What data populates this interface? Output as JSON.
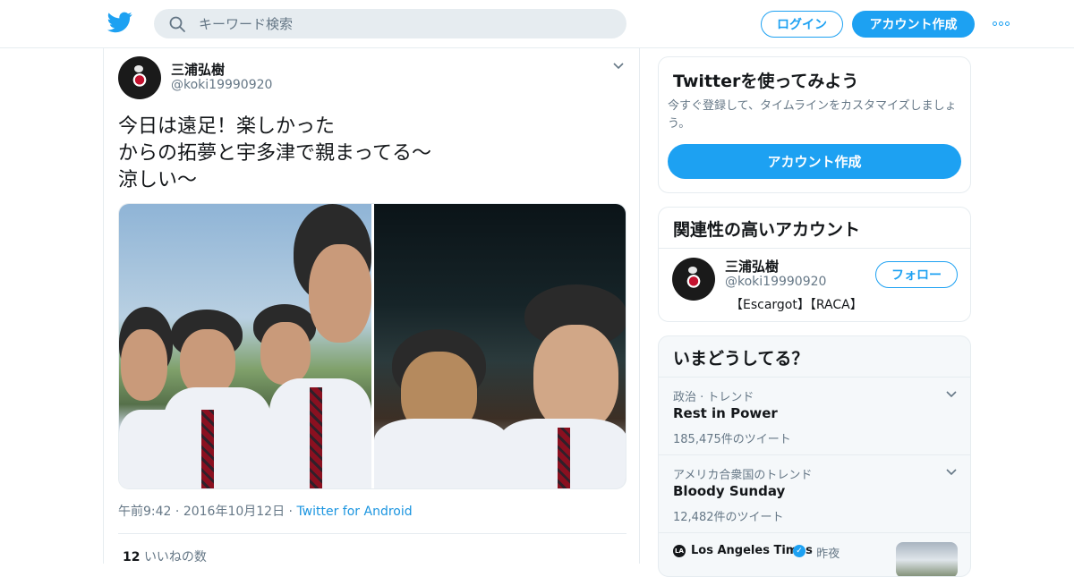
{
  "header": {
    "search_placeholder": "キーワード検索",
    "login_label": "ログイン",
    "signup_label": "アカウント作成"
  },
  "tweet": {
    "author_name": "三浦弘樹",
    "author_handle": "@koki19990920",
    "text_lines": [
      "今日は遠足！楽しかった",
      "からの拓夢と宇多津で親まってる～",
      "涼しい～"
    ],
    "time": "午前9:42",
    "date": "2016年10月12日",
    "client": "Twitter for Android",
    "likes_count": "12",
    "likes_label": "いいねの数"
  },
  "signup_card": {
    "title": "Twitterを使ってみよう",
    "description": "今すぐ登録して、タイムラインをカスタマイズしましょう。",
    "cta_label": "アカウント作成"
  },
  "related": {
    "title": "関連性の高いアカウント",
    "account": {
      "name": "三浦弘樹",
      "handle": "@koki19990920",
      "bio": "【Escargot】【RACA】",
      "follow_label": "フォロー"
    }
  },
  "trends": {
    "title": "いまどうしてる？",
    "items": [
      {
        "context": "政治 · トレンド",
        "name": "Rest in Power",
        "count": "185,475件のツイート"
      },
      {
        "context": "アメリカ合衆国のトレンド",
        "name": "Bloody Sunday",
        "count": "12,482件のツイート"
      }
    ],
    "news": {
      "source": "Los Angeles Times",
      "source_abbr": "LA",
      "when": "昨夜"
    }
  },
  "colors": {
    "brand": "#1da1f2",
    "text": "#14171a",
    "muted": "#657786",
    "link": "#1b95e0",
    "border": "#e6ecf0"
  },
  "icons": [
    "twitter-logo-icon",
    "search-icon",
    "more-icon",
    "chevron-down-icon",
    "verified-icon"
  ]
}
